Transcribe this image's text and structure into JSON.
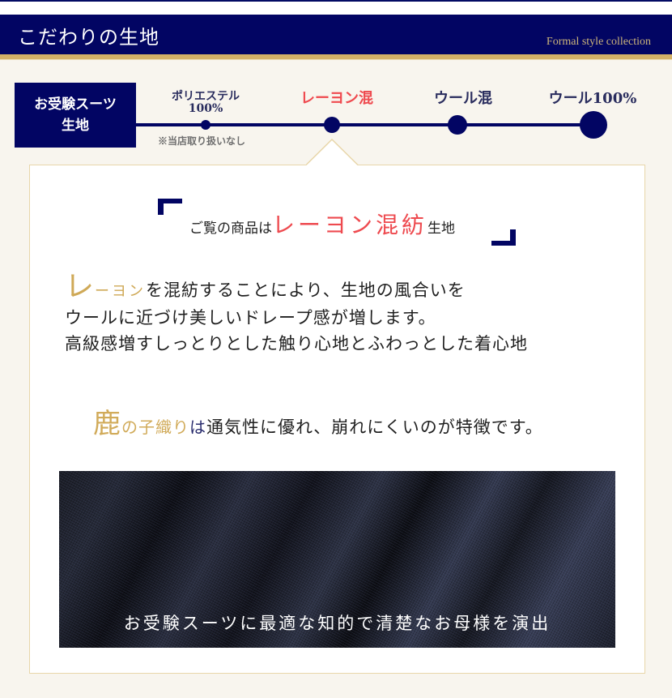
{
  "header": {
    "title": "こだわりの生地",
    "subtitle": "Formal style collection",
    "colors": {
      "navy": "#020563",
      "gold": "#d3b067",
      "background": "#f8f5ee"
    }
  },
  "timeline": {
    "category_label_line1": "お受験スーツ",
    "category_label_line2": "生地",
    "steps": [
      {
        "label_line1": "ポリエステル",
        "label_line2": "100%",
        "note": "※当店取り扱いなし",
        "active": false
      },
      {
        "label": "レーヨン混",
        "active": true
      },
      {
        "label": "ウール混",
        "active": false
      },
      {
        "label": "ウール100%",
        "active": false
      }
    ],
    "active_color": "#ef4a4f"
  },
  "panel": {
    "headline_pre": "ご覧の商品は",
    "headline_accent": "レーヨン混紡",
    "headline_post": "生地",
    "description": {
      "line1_gold_big": "レ",
      "line1_gold_small": "ーヨン",
      "line1_rest": "を混紡することにより、生地の風合いを",
      "line2": "ウールに近づけ美しいドレープ感が増します。",
      "line3": "高級感増すしっとりとした触り心地とふわっとした着心地"
    },
    "feature": {
      "gold_big": "鹿",
      "gold_small": "の子織り",
      "navy": "は",
      "rest": "通気性に優れ、崩れにくいのが特徴です。"
    },
    "image": {
      "alt": "navy fabric close-up",
      "caption": "お受験スーツに最適な知的で清楚なお母様を演出"
    }
  }
}
